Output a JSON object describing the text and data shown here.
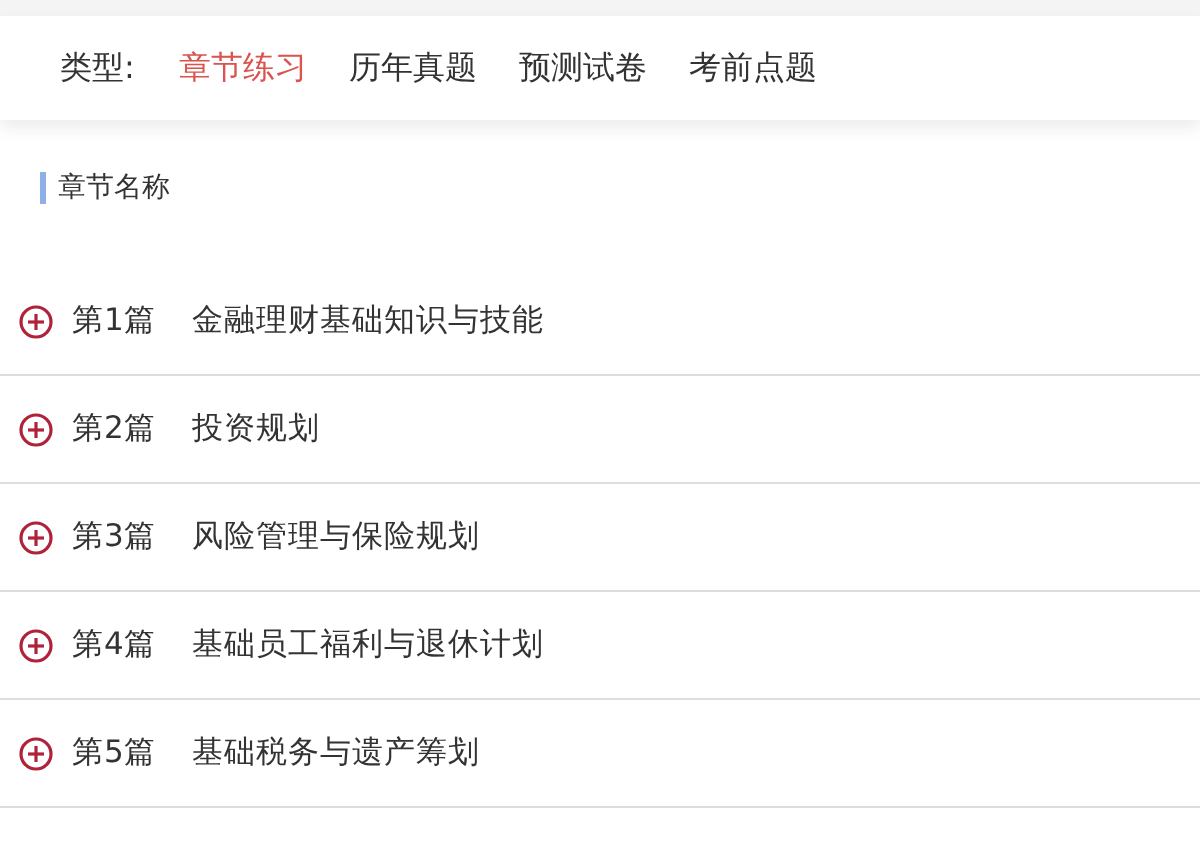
{
  "filter": {
    "label": "类型:",
    "options": [
      {
        "label": "章节练习",
        "selected": true
      },
      {
        "label": "历年真题",
        "selected": false
      },
      {
        "label": "预测试卷",
        "selected": false
      },
      {
        "label": "考前点题",
        "selected": false
      }
    ]
  },
  "section_title": "章节名称",
  "chapters": [
    {
      "number": "第1篇",
      "title": "金融理财基础知识与技能",
      "expanded": false
    },
    {
      "number": "第2篇",
      "title": "投资规划",
      "expanded": false
    },
    {
      "number": "第3篇",
      "title": "风险管理与保险规划",
      "expanded": false
    },
    {
      "number": "第4篇",
      "title": "基础员工福利与退休计划",
      "expanded": false
    },
    {
      "number": "第5篇",
      "title": "基础税务与遗产筹划",
      "expanded": false
    }
  ]
}
